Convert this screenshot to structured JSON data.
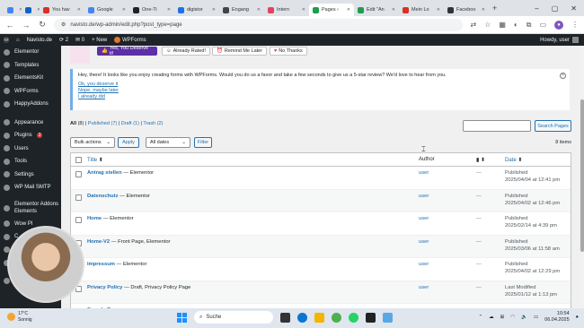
{
  "browser": {
    "tabs": [
      {
        "label": "",
        "color": "#4285f4"
      },
      {
        "label": "",
        "color": "#0a66c2"
      },
      {
        "label": "You hav",
        "color": "#d93025"
      },
      {
        "label": "Google",
        "color": "#4285f4"
      },
      {
        "label": "One-Ti",
        "color": "#222222"
      },
      {
        "label": "digistor",
        "color": "#1a73e8"
      },
      {
        "label": "Engang",
        "color": "#444444"
      },
      {
        "label": "Intern",
        "color": "#e4405f"
      },
      {
        "label": "Pages ‹",
        "color": "#1d9d4d"
      },
      {
        "label": "Edit \"An",
        "color": "#1d9d4d"
      },
      {
        "label": "Mein Lo",
        "color": "#d93025"
      },
      {
        "label": "Faceboo",
        "color": "#333333"
      }
    ],
    "active_tab": 8,
    "url": "navisto.de/wp-admin/edit.php?post_type=page"
  },
  "adminbar": {
    "site": "Navisto.de",
    "updates": "2",
    "comments": "0",
    "new": "New",
    "plugin": "WPForms",
    "howdy": "Howdy, user"
  },
  "sidebar": [
    {
      "label": "Elementor"
    },
    {
      "label": "Templates"
    },
    {
      "label": "ElementsKit"
    },
    {
      "label": "WPForms"
    },
    {
      "label": "HappyAddons"
    },
    {
      "label": ""
    },
    {
      "label": "Appearance"
    },
    {
      "label": "Plugins",
      "badge": "2"
    },
    {
      "label": "Users"
    },
    {
      "label": "Tools"
    },
    {
      "label": "Settings"
    },
    {
      "label": "WP Mail SMTP"
    },
    {
      "label": ""
    },
    {
      "label": "Elementor Addons Elements",
      "two": true
    },
    {
      "label": "Wow Pl"
    },
    {
      "label": "C"
    },
    {
      "label": "G"
    },
    {
      "label": "A"
    },
    {
      "label": ""
    },
    {
      "label": "Collapse m"
    }
  ],
  "review_buttons": {
    "deserve": "Yes, You Deserve It!",
    "rated": "Already Rated!",
    "later": "Remind Me Later",
    "no": "No Thanks"
  },
  "notice": {
    "message": "Hey, there! It looks like you enjoy creating forms with WPForms. Would you do us a favor and take a few seconds to give us a 5-star review? We'd love to hear from you.",
    "link1": "Ok, you deserve it",
    "link2": "Nope, maybe later",
    "link3": "I already did"
  },
  "filters": {
    "all": "All",
    "all_count": "(8)",
    "published": "Published",
    "published_count": "(7)",
    "draft": "Draft",
    "draft_count": "(1)",
    "trash": "Trash",
    "trash_count": "(2)"
  },
  "search_button": "Search Pages",
  "bulk_actions": "Bulk actions",
  "apply": "Apply",
  "all_dates": "All dates",
  "filter": "Filter",
  "items_count": "8 items",
  "columns": {
    "title": "Title",
    "author": "Author",
    "date": "Date"
  },
  "rows": [
    {
      "title": "Antrag stellen",
      "suffix": " — Elementor",
      "author": "user",
      "comments": "—",
      "status": "Published",
      "date": "2025/04/04 at 12:41 pm"
    },
    {
      "title": "Datenschutz",
      "suffix": " — Elementor",
      "author": "user",
      "comments": "—",
      "status": "Published",
      "date": "2025/04/02 at 12:46 pm"
    },
    {
      "title": "Home",
      "suffix": " — Elementor",
      "author": "user",
      "comments": "—",
      "status": "Published",
      "date": "2025/02/14 at 4:39 pm"
    },
    {
      "title": "Home-V2",
      "suffix": " — Front Page, Elementor",
      "author": "user",
      "comments": "—",
      "status": "Published",
      "date": "2025/03/06 at 11:58 am"
    },
    {
      "title": "Impressum",
      "suffix": " — Elementor",
      "author": "user",
      "comments": "—",
      "status": "Published",
      "date": "2025/04/02 at 12:29 pm"
    },
    {
      "title": "Privacy Policy",
      "suffix": " — Draft, Privacy Policy Page",
      "author": "user",
      "comments": "—",
      "status": "Last Modified",
      "date": "2025/01/12 at 1:13 pm"
    },
    {
      "title": "Sample Page",
      "suffix": "",
      "author": "user",
      "comments": "",
      "status": "",
      "date": ""
    }
  ],
  "taskbar": {
    "temp": "17°C",
    "weather": "Sonnig",
    "search": "Suche",
    "time": "10:54",
    "date": "06.04.2025"
  }
}
